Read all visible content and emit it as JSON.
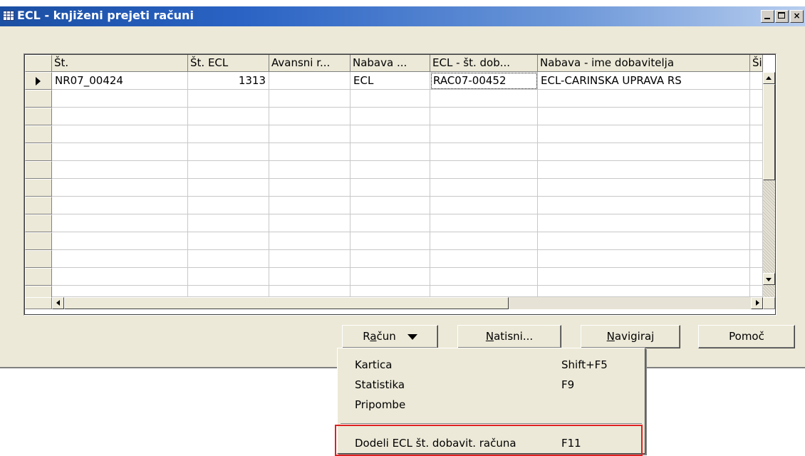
{
  "window": {
    "title": "ECL - knjiženi prejeti računi",
    "controls": {
      "minimize": "_",
      "maximize": "□",
      "close": "×"
    }
  },
  "grid": {
    "columns": [
      "Št.",
      "Št. ECL",
      "Avansni r...",
      "Nabava ...",
      "ECL - št. dob...",
      "Nabava - ime dobavitelja",
      "Šifr"
    ],
    "rows": [
      [
        "NR07_00424",
        "1313",
        "",
        "ECL",
        "RAC07-00452",
        "ECL-CARINSKA UPRAVA RS",
        ""
      ]
    ]
  },
  "buttons": {
    "racun_pre": "R",
    "racun_u": "a",
    "racun_post": "čun",
    "natisni_u": "N",
    "natisni_post": "atisni...",
    "navigiraj_u": "N",
    "navigiraj_post": "avigiraj",
    "pomoc": "Pomoč"
  },
  "menu": {
    "items": [
      {
        "label": "Kartica",
        "shortcut": "Shift+F5"
      },
      {
        "label": "Statistika",
        "shortcut": "F9"
      },
      {
        "label": "Pripombe",
        "shortcut": ""
      },
      {
        "label": "Dodeli ECL št. dobavit. računa",
        "shortcut": "F11"
      }
    ]
  },
  "colors": {
    "highlight_box": "#e02020",
    "titlebar": "#2a63c4"
  },
  "icons": [
    "table-icon",
    "row-pointer-icon",
    "scroll-up-icon",
    "scroll-down-icon",
    "scroll-left-icon",
    "scroll-right-icon",
    "chevron-down-icon"
  ]
}
